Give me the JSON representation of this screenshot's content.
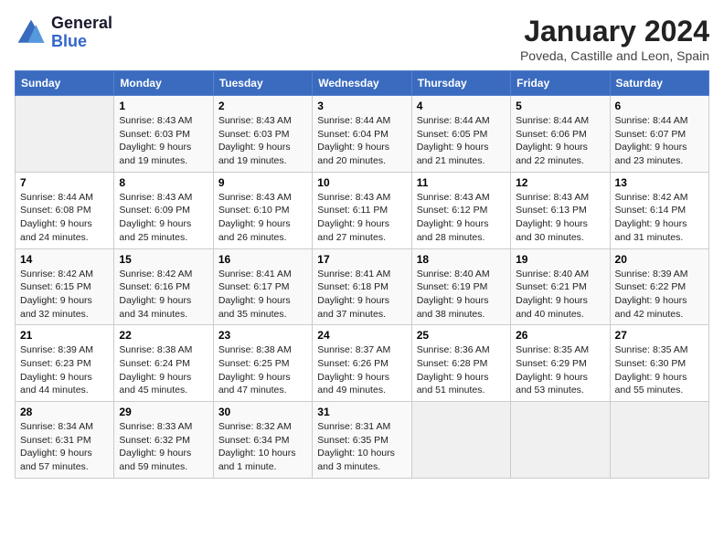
{
  "logo": {
    "line1": "General",
    "line2": "Blue"
  },
  "title": "January 2024",
  "subtitle": "Poveda, Castille and Leon, Spain",
  "headers": [
    "Sunday",
    "Monday",
    "Tuesday",
    "Wednesday",
    "Thursday",
    "Friday",
    "Saturday"
  ],
  "weeks": [
    [
      {
        "day": "",
        "info": ""
      },
      {
        "day": "1",
        "info": "Sunrise: 8:43 AM\nSunset: 6:03 PM\nDaylight: 9 hours\nand 19 minutes."
      },
      {
        "day": "2",
        "info": "Sunrise: 8:43 AM\nSunset: 6:03 PM\nDaylight: 9 hours\nand 19 minutes."
      },
      {
        "day": "3",
        "info": "Sunrise: 8:44 AM\nSunset: 6:04 PM\nDaylight: 9 hours\nand 20 minutes."
      },
      {
        "day": "4",
        "info": "Sunrise: 8:44 AM\nSunset: 6:05 PM\nDaylight: 9 hours\nand 21 minutes."
      },
      {
        "day": "5",
        "info": "Sunrise: 8:44 AM\nSunset: 6:06 PM\nDaylight: 9 hours\nand 22 minutes."
      },
      {
        "day": "6",
        "info": "Sunrise: 8:44 AM\nSunset: 6:07 PM\nDaylight: 9 hours\nand 23 minutes."
      }
    ],
    [
      {
        "day": "7",
        "info": "Sunrise: 8:44 AM\nSunset: 6:08 PM\nDaylight: 9 hours\nand 24 minutes."
      },
      {
        "day": "8",
        "info": "Sunrise: 8:43 AM\nSunset: 6:09 PM\nDaylight: 9 hours\nand 25 minutes."
      },
      {
        "day": "9",
        "info": "Sunrise: 8:43 AM\nSunset: 6:10 PM\nDaylight: 9 hours\nand 26 minutes."
      },
      {
        "day": "10",
        "info": "Sunrise: 8:43 AM\nSunset: 6:11 PM\nDaylight: 9 hours\nand 27 minutes."
      },
      {
        "day": "11",
        "info": "Sunrise: 8:43 AM\nSunset: 6:12 PM\nDaylight: 9 hours\nand 28 minutes."
      },
      {
        "day": "12",
        "info": "Sunrise: 8:43 AM\nSunset: 6:13 PM\nDaylight: 9 hours\nand 30 minutes."
      },
      {
        "day": "13",
        "info": "Sunrise: 8:42 AM\nSunset: 6:14 PM\nDaylight: 9 hours\nand 31 minutes."
      }
    ],
    [
      {
        "day": "14",
        "info": "Sunrise: 8:42 AM\nSunset: 6:15 PM\nDaylight: 9 hours\nand 32 minutes."
      },
      {
        "day": "15",
        "info": "Sunrise: 8:42 AM\nSunset: 6:16 PM\nDaylight: 9 hours\nand 34 minutes."
      },
      {
        "day": "16",
        "info": "Sunrise: 8:41 AM\nSunset: 6:17 PM\nDaylight: 9 hours\nand 35 minutes."
      },
      {
        "day": "17",
        "info": "Sunrise: 8:41 AM\nSunset: 6:18 PM\nDaylight: 9 hours\nand 37 minutes."
      },
      {
        "day": "18",
        "info": "Sunrise: 8:40 AM\nSunset: 6:19 PM\nDaylight: 9 hours\nand 38 minutes."
      },
      {
        "day": "19",
        "info": "Sunrise: 8:40 AM\nSunset: 6:21 PM\nDaylight: 9 hours\nand 40 minutes."
      },
      {
        "day": "20",
        "info": "Sunrise: 8:39 AM\nSunset: 6:22 PM\nDaylight: 9 hours\nand 42 minutes."
      }
    ],
    [
      {
        "day": "21",
        "info": "Sunrise: 8:39 AM\nSunset: 6:23 PM\nDaylight: 9 hours\nand 44 minutes."
      },
      {
        "day": "22",
        "info": "Sunrise: 8:38 AM\nSunset: 6:24 PM\nDaylight: 9 hours\nand 45 minutes."
      },
      {
        "day": "23",
        "info": "Sunrise: 8:38 AM\nSunset: 6:25 PM\nDaylight: 9 hours\nand 47 minutes."
      },
      {
        "day": "24",
        "info": "Sunrise: 8:37 AM\nSunset: 6:26 PM\nDaylight: 9 hours\nand 49 minutes."
      },
      {
        "day": "25",
        "info": "Sunrise: 8:36 AM\nSunset: 6:28 PM\nDaylight: 9 hours\nand 51 minutes."
      },
      {
        "day": "26",
        "info": "Sunrise: 8:35 AM\nSunset: 6:29 PM\nDaylight: 9 hours\nand 53 minutes."
      },
      {
        "day": "27",
        "info": "Sunrise: 8:35 AM\nSunset: 6:30 PM\nDaylight: 9 hours\nand 55 minutes."
      }
    ],
    [
      {
        "day": "28",
        "info": "Sunrise: 8:34 AM\nSunset: 6:31 PM\nDaylight: 9 hours\nand 57 minutes."
      },
      {
        "day": "29",
        "info": "Sunrise: 8:33 AM\nSunset: 6:32 PM\nDaylight: 9 hours\nand 59 minutes."
      },
      {
        "day": "30",
        "info": "Sunrise: 8:32 AM\nSunset: 6:34 PM\nDaylight: 10 hours\nand 1 minute."
      },
      {
        "day": "31",
        "info": "Sunrise: 8:31 AM\nSunset: 6:35 PM\nDaylight: 10 hours\nand 3 minutes."
      },
      {
        "day": "",
        "info": ""
      },
      {
        "day": "",
        "info": ""
      },
      {
        "day": "",
        "info": ""
      }
    ]
  ]
}
